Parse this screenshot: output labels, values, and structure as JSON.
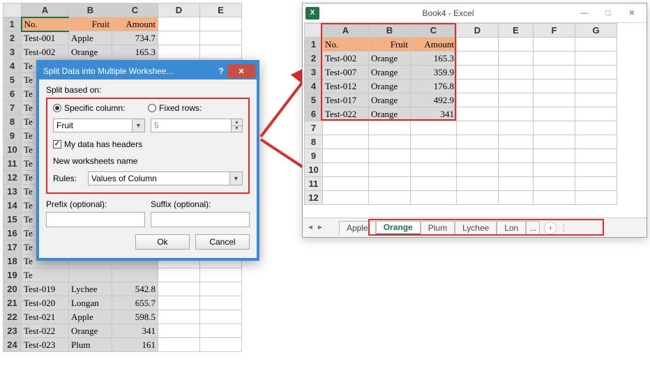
{
  "left_sheet": {
    "cols": [
      "A",
      "B",
      "C",
      "D",
      "E"
    ],
    "header": {
      "no": "No.",
      "fruit": "Fruit",
      "amount": "Amount"
    },
    "rows": [
      {
        "no": "Test-001",
        "fruit": "Apple",
        "amount": "734.7"
      },
      {
        "no": "Test-002",
        "fruit": "Orange",
        "amount": "165.3"
      },
      {
        "no": "Te",
        "fruit": "",
        "amount": ""
      },
      {
        "no": "Te",
        "fruit": "",
        "amount": ""
      },
      {
        "no": "Te",
        "fruit": "",
        "amount": ""
      },
      {
        "no": "Te",
        "fruit": "",
        "amount": ""
      },
      {
        "no": "Te",
        "fruit": "",
        "amount": ""
      },
      {
        "no": "Te",
        "fruit": "",
        "amount": ""
      },
      {
        "no": "Te",
        "fruit": "",
        "amount": ""
      },
      {
        "no": "Te",
        "fruit": "",
        "amount": ""
      },
      {
        "no": "Te",
        "fruit": "",
        "amount": ""
      },
      {
        "no": "Te",
        "fruit": "",
        "amount": ""
      },
      {
        "no": "Te",
        "fruit": "",
        "amount": ""
      },
      {
        "no": "Te",
        "fruit": "",
        "amount": ""
      },
      {
        "no": "Te",
        "fruit": "",
        "amount": ""
      },
      {
        "no": "Te",
        "fruit": "",
        "amount": ""
      },
      {
        "no": "Te",
        "fruit": "",
        "amount": ""
      },
      {
        "no": "Te",
        "fruit": "",
        "amount": ""
      },
      {
        "no": "Test-019",
        "fruit": "Lychee",
        "amount": "542.8"
      },
      {
        "no": "Test-020",
        "fruit": "Longan",
        "amount": "655.7"
      },
      {
        "no": "Test-021",
        "fruit": "Apple",
        "amount": "598.5"
      },
      {
        "no": "Test-022",
        "fruit": "Orange",
        "amount": "341"
      },
      {
        "no": "Test-023",
        "fruit": "Plum",
        "amount": "161"
      }
    ]
  },
  "dialog": {
    "title": "Split Data into Multiple Workshee...",
    "section_label": "Split based on:",
    "specific_column_label": "Specific column:",
    "fixed_rows_label": "Fixed rows:",
    "column_select_value": "Fruit",
    "fixed_rows_value": "5",
    "has_headers_label": "My data has headers",
    "has_headers_checked": true,
    "worksheets_name_label": "New worksheets name",
    "rules_label": "Rules:",
    "rules_value": "Values of Column",
    "prefix_label": "Prefix (optional):",
    "suffix_label": "Suffix (optional):",
    "prefix_value": "",
    "suffix_value": "",
    "ok_label": "Ok",
    "cancel_label": "Cancel",
    "split_mode": "column"
  },
  "excel_window": {
    "title": "Book4 - Excel",
    "cols": [
      "A",
      "B",
      "C",
      "D",
      "E",
      "F",
      "G"
    ],
    "header": {
      "no": "No.",
      "fruit": "Fruit",
      "amount": "Amount"
    },
    "rows": [
      {
        "no": "Test-002",
        "fruit": "Orange",
        "amount": "165.3"
      },
      {
        "no": "Test-007",
        "fruit": "Orange",
        "amount": "359.9"
      },
      {
        "no": "Test-012",
        "fruit": "Orange",
        "amount": "176.8"
      },
      {
        "no": "Test-017",
        "fruit": "Orange",
        "amount": "492.9"
      },
      {
        "no": "Test-022",
        "fruit": "Orange",
        "amount": "341"
      }
    ],
    "blank_rows": [
      "7",
      "8",
      "9",
      "10",
      "11",
      "12"
    ],
    "tabs": [
      "Apple",
      "Orange",
      "Plum",
      "Lychee",
      "Lon"
    ],
    "tab_overflow": "...",
    "active_tab": "Orange"
  }
}
